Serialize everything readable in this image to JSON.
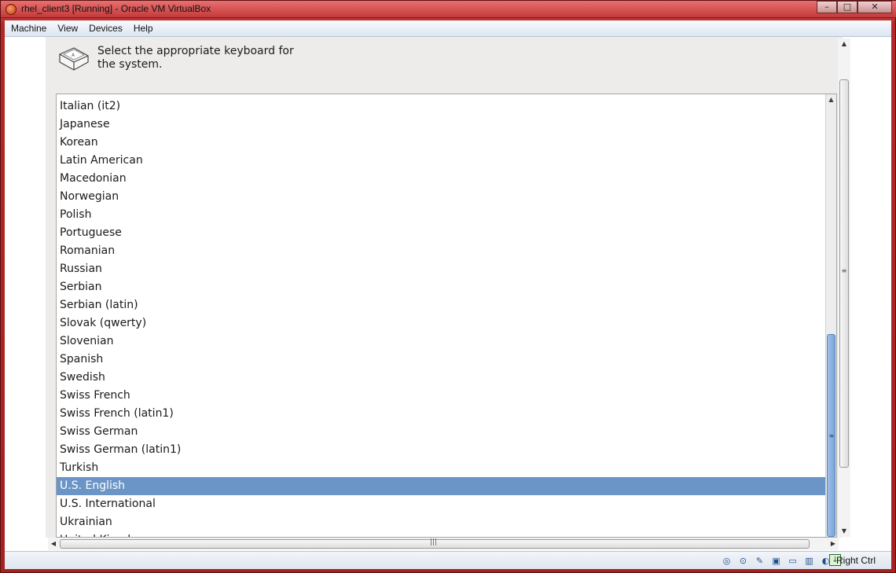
{
  "window": {
    "title": "rhel_client3 [Running] - Oracle VM VirtualBox",
    "controls": {
      "minimize": "–",
      "maximize": "□",
      "close": "✕"
    }
  },
  "menu": [
    "Machine",
    "View",
    "Devices",
    "Help"
  ],
  "installer": {
    "prompt": "Select the appropriate keyboard for the system.",
    "keyboard_layouts": [
      "Italian (it2)",
      "Japanese",
      "Korean",
      "Latin American",
      "Macedonian",
      "Norwegian",
      "Polish",
      "Portuguese",
      "Romanian",
      "Russian",
      "Serbian",
      "Serbian (latin)",
      "Slovak (qwerty)",
      "Slovenian",
      "Spanish",
      "Swedish",
      "Swiss French",
      "Swiss French (latin1)",
      "Swiss German",
      "Swiss German (latin1)",
      "Turkish",
      "U.S. English",
      "U.S. International",
      "Ukrainian",
      "United Kingdom"
    ],
    "selected": "U.S. English"
  },
  "scrollbars": {
    "up_arrow": "▲",
    "down_arrow": "▼",
    "left_arrow": "◀",
    "right_arrow": "▶",
    "grip_v": "≡",
    "grip_h": "|||"
  },
  "statusbar": {
    "icons": [
      "hard-disk-icon",
      "optical-drive-icon",
      "usb-icon",
      "network-icon",
      "shared-folders-icon",
      "display-icon",
      "mouse-integration-icon"
    ],
    "host_key": "Right Ctrl"
  },
  "colors": {
    "selection": "#6c95c7",
    "window_frame": "#c83a3a",
    "guest_background": "#edeceb"
  }
}
